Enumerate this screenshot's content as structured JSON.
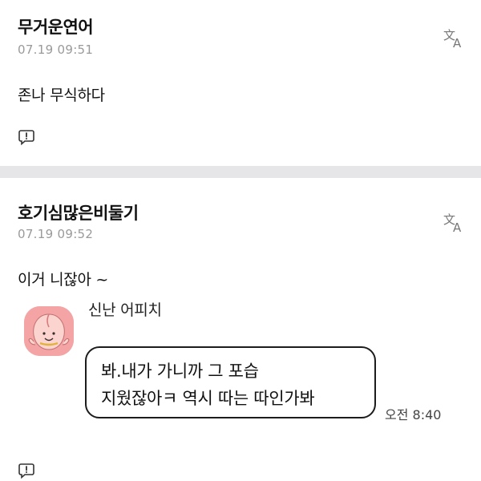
{
  "comments": [
    {
      "nickname": "무거운연어",
      "date": "07.19 09:51",
      "text": "존나 무식하다",
      "translate_icon": "translate-icon",
      "report_icon": "report-icon"
    },
    {
      "nickname": "호기심많은비둘기",
      "date": "07.19 09:52",
      "text": "이거 니잖아 ~",
      "translate_icon": "translate-icon",
      "report_icon": "report-icon",
      "chat_capture": {
        "sender": "신난 어피치",
        "lines": [
          "봐.내가 가니까 그 포습",
          "지웠잖아ㅋ 역시 따는 따인가봐"
        ],
        "time": "오전 8:40",
        "avatar_icon": "apeach-avatar-icon"
      }
    }
  ],
  "colors": {
    "divider": "#e6e6e9",
    "date": "#9a9a9a",
    "avatar_bg": "#f4a4a4"
  }
}
